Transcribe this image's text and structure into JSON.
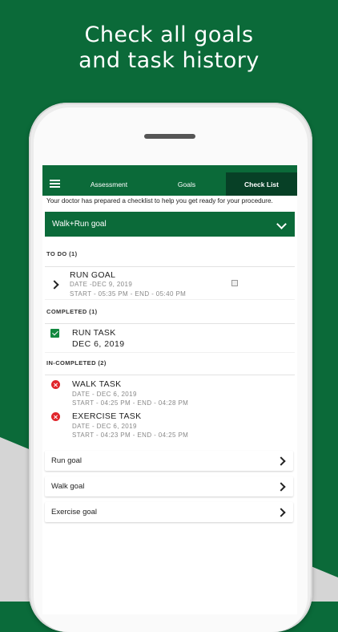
{
  "headline": {
    "line1": "Check all goals",
    "line2": "and task history"
  },
  "nav": {
    "tabs": [
      {
        "label": "Assessment"
      },
      {
        "label": "Goals"
      },
      {
        "label": "Check List"
      }
    ],
    "active_tab": "Check List"
  },
  "intro_text": "Your doctor has prepared a checklist to help you get ready for your procedure.",
  "goal_header": "Walk+Run goal",
  "sections": {
    "todo": {
      "label": "TO DO (1)",
      "tasks": [
        {
          "title": "RUN GOAL",
          "date": "DATE -DEC 9, 2019",
          "time": "START - 05:35 PM - END - 05:40 PM"
        }
      ]
    },
    "completed": {
      "label": "COMPLETED (1)",
      "tasks": [
        {
          "title": "RUN TASK",
          "date": "DEC 6, 2019"
        }
      ]
    },
    "incompleted": {
      "label": "IN-COMPLETED (2)",
      "tasks": [
        {
          "title": "WALK TASK",
          "date": "DATE - DEC 6, 2019",
          "time": "START - 04:25 PM - END - 04:28 PM"
        },
        {
          "title": "EXERCISE TASK",
          "date": "DATE - DEC 6, 2019",
          "time": "START - 04:23 PM - END - 04:25 PM"
        }
      ]
    }
  },
  "goal_list": [
    {
      "label": "Run goal"
    },
    {
      "label": "Walk goal"
    },
    {
      "label": "Exercise goal"
    }
  ],
  "colors": {
    "brand_green": "#0b6a39",
    "active_tab": "#074026",
    "completed_check": "#12883f",
    "incomplete_x": "#e0252b"
  },
  "icons": [
    "menu-icon",
    "chevron-down-icon",
    "chevron-right-icon",
    "checkbox-icon",
    "check-icon",
    "x-circle-icon"
  ]
}
